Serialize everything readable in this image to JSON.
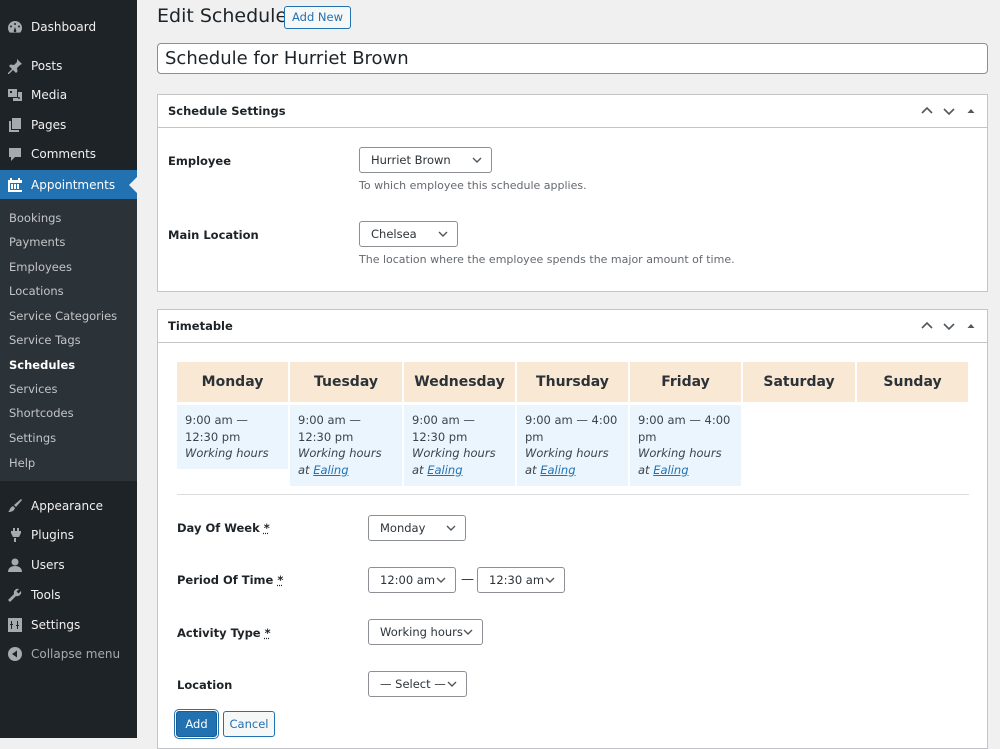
{
  "sidebar": {
    "top_items": [
      {
        "label": "Dashboard",
        "icon": "dashboard-icon"
      },
      {
        "label": "Posts",
        "icon": "pin-icon"
      },
      {
        "label": "Media",
        "icon": "media-icon"
      },
      {
        "label": "Pages",
        "icon": "pages-icon"
      },
      {
        "label": "Comments",
        "icon": "comment-icon"
      },
      {
        "label": "Appointments",
        "icon": "calendar-icon",
        "active": true
      }
    ],
    "submenu": [
      {
        "label": "Bookings"
      },
      {
        "label": "Payments"
      },
      {
        "label": "Employees"
      },
      {
        "label": "Locations"
      },
      {
        "label": "Service Categories"
      },
      {
        "label": "Service Tags"
      },
      {
        "label": "Schedules",
        "current": true
      },
      {
        "label": "Services"
      },
      {
        "label": "Shortcodes"
      },
      {
        "label": "Settings"
      },
      {
        "label": "Help"
      }
    ],
    "bottom_items": [
      {
        "label": "Appearance",
        "icon": "brush-icon"
      },
      {
        "label": "Plugins",
        "icon": "plugin-icon"
      },
      {
        "label": "Users",
        "icon": "user-icon"
      },
      {
        "label": "Tools",
        "icon": "wrench-icon"
      },
      {
        "label": "Settings",
        "icon": "settings-icon"
      },
      {
        "label": "Collapse menu",
        "icon": "collapse-icon"
      }
    ]
  },
  "header": {
    "title": "Edit Schedule",
    "add_new_label": "Add New"
  },
  "post_title": {
    "value": "Schedule for Hurriet Brown"
  },
  "schedule_settings": {
    "title": "Schedule Settings",
    "employee": {
      "label": "Employee",
      "value": "Hurriet Brown",
      "description": "To which employee this schedule applies."
    },
    "main_location": {
      "label": "Main Location",
      "value": "Chelsea",
      "description": "The location where the employee spends the major amount of time."
    }
  },
  "timetable": {
    "title": "Timetable",
    "days": [
      {
        "name": "Monday",
        "time": "9:00 am — 12:30 pm",
        "activity": "Working hours",
        "at": "",
        "location": ""
      },
      {
        "name": "Tuesday",
        "time": "9:00 am — 12:30 pm",
        "activity": "Working hours",
        "at": "at",
        "location": "Ealing"
      },
      {
        "name": "Wednesday",
        "time": "9:00 am — 12:30 pm",
        "activity": "Working hours",
        "at": "at",
        "location": "Ealing"
      },
      {
        "name": "Thursday",
        "time": "9:00 am — 4:00 pm",
        "activity": "Working hours",
        "at": "at",
        "location": "Ealing"
      },
      {
        "name": "Friday",
        "time": "9:00 am — 4:00 pm",
        "activity": "Working hours",
        "at": "at",
        "location": "Ealing"
      },
      {
        "name": "Saturday"
      },
      {
        "name": "Sunday"
      }
    ],
    "form": {
      "day_of_week": {
        "label": "Day Of Week",
        "required": "*",
        "value": "Monday"
      },
      "period": {
        "label": "Period Of Time",
        "required": "*",
        "start": "12:00 am",
        "separator": "—",
        "end": "12:30 am"
      },
      "activity_type": {
        "label": "Activity Type",
        "required": "*",
        "value": "Working hours"
      },
      "location": {
        "label": "Location",
        "value": "— Select —"
      },
      "add_label": "Add",
      "cancel_label": "Cancel"
    }
  },
  "colors": {
    "accent": "#2271b1",
    "sidebar_bg": "#1d2327",
    "submenu_bg": "#2c3338",
    "day_header_bg": "#f9e8d4",
    "slot_bg": "#eaf5fe"
  }
}
